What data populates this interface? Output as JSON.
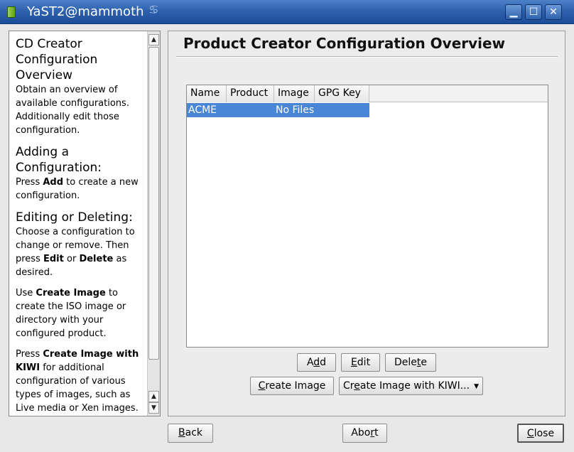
{
  "window": {
    "title": "YaST2@mammoth",
    "title_glyph": "♋",
    "minimize_glyph": "▁",
    "maximize_glyph": "☐",
    "close_glyph": "✕"
  },
  "help": {
    "h1": "CD Creator Configuration Overview",
    "p1": "Obtain an overview of available configurations. Additionally edit those configuration.",
    "h2": "Adding a Configuration:",
    "p2_a": "Press ",
    "p2_b": "Add",
    "p2_c": " to create a new configuration.",
    "h3": "Editing or Deleting:",
    "p3_a": "Choose a configuration to change or remove. Then press ",
    "p3_b": "Edit",
    "p3_c": " or ",
    "p3_d": "Delete",
    "p3_e": " as desired.",
    "p4_a": "Use ",
    "p4_b": "Create Image",
    "p4_c": " to create the ISO image or directory with your configured product.",
    "p5_a": "Press ",
    "p5_b": "Create Image with KIWI",
    "p5_c": " for additional configuration of various types of images, such as Live media or Xen images."
  },
  "main": {
    "title": "Product Creator Configuration Overview",
    "table": {
      "columns": [
        "Name",
        "Product",
        "Image",
        "GPG Key"
      ],
      "rows": [
        {
          "name": "ACME",
          "product": "",
          "image": "No Files",
          "gpg_key": ""
        }
      ]
    },
    "buttons": {
      "add_pre": "A",
      "add_mn": "d",
      "add_post": "d",
      "edit_pre": "",
      "edit_mn": "E",
      "edit_post": "dit",
      "delete_pre": "Dele",
      "delete_mn": "t",
      "delete_post": "e",
      "create_pre": "",
      "create_mn": "C",
      "create_post": "reate Image",
      "kiwi_pre": "Cr",
      "kiwi_mn": "e",
      "kiwi_post": "ate Image with KIWI..."
    }
  },
  "footer": {
    "back_pre": "",
    "back_mn": "B",
    "back_post": "ack",
    "abort_pre": "Abo",
    "abort_mn": "r",
    "abort_post": "t",
    "close_pre": "",
    "close_mn": "C",
    "close_post": "lose"
  }
}
